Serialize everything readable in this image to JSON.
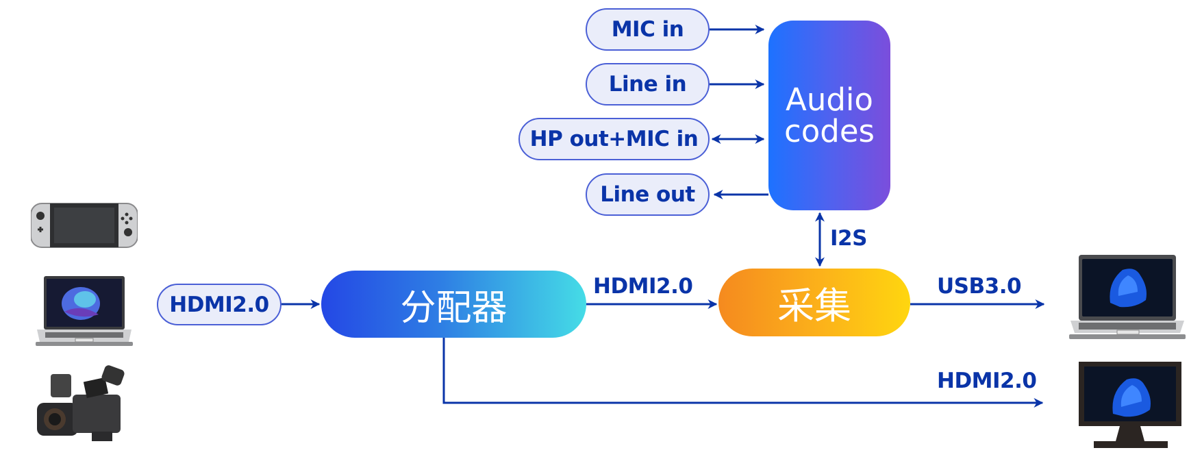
{
  "diagram": {
    "audio_inputs": [
      {
        "label": "MIC in",
        "direction": "in"
      },
      {
        "label": "Line in",
        "direction": "in"
      },
      {
        "label": "HP out+MIC in",
        "direction": "bidirectional"
      },
      {
        "label": "Line out",
        "direction": "out"
      }
    ],
    "audio_codec": {
      "line1": "Audio",
      "line2": "codes"
    },
    "i2s_label": "I2S",
    "input_label": "HDMI2.0",
    "splitter_label": "分配器",
    "splitter_to_capture_label": "HDMI2.0",
    "capture_label": "采集",
    "usb_label": "USB3.0",
    "hdmi_out_label": "HDMI2.0",
    "source_devices": [
      "game-console",
      "laptop",
      "camcorder"
    ],
    "output_devices": [
      "laptop",
      "monitor"
    ],
    "colors": {
      "line": "#0a34a8",
      "pill_fill": "#eaedfa",
      "pill_border": "#4a5fd6",
      "audio_gradient": [
        "#1d72ff",
        "#7b4edc"
      ],
      "splitter_gradient": [
        "#2448e5",
        "#45dce6"
      ],
      "capture_gradient": [
        "#f58a1f",
        "#ffd60f"
      ]
    }
  }
}
